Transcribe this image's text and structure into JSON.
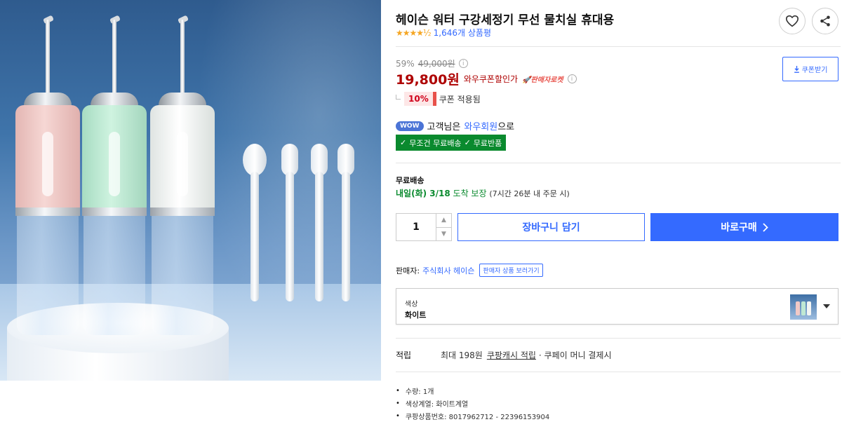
{
  "product": {
    "title": "헤이슨 워터 구강세정기 무선 물치실 휴대용",
    "rating_stars": "★★★★½",
    "review_count": "1,646개 상품평"
  },
  "price": {
    "discount_rate": "59%",
    "original_price": "49,000원",
    "sale_price": "19,800원",
    "sale_label": "와우쿠폰할인가",
    "seller_badge": "판매자로켓",
    "coupon_button": "쿠폰받기"
  },
  "coupon": {
    "percent": "10%",
    "applied_text": "쿠폰 적용됨"
  },
  "wow": {
    "badge": "WOW",
    "prefix": "고객님은",
    "member": "와우회원",
    "suffix": "으로",
    "benefit_1": "무조건 무료배송",
    "benefit_2": "무료반품"
  },
  "shipping": {
    "label": "무료배송",
    "date": "내일(화) 3/18",
    "guarantee": "도착 보장",
    "note": "(7시간 26분 내 주문 시)"
  },
  "purchase": {
    "quantity": "1",
    "cart_button": "장바구니 담기",
    "buy_button": "바로구매"
  },
  "seller": {
    "label": "판매자:",
    "name": "주식회사 헤이슨",
    "tag": "판매자 상품 보러가기"
  },
  "option": {
    "label": "색상",
    "value": "화이트"
  },
  "reward": {
    "label": "적립",
    "prefix": "최대 198원",
    "cash": "쿠팡캐시 적립",
    "suffix": "· 쿠페이 머니 결제시"
  },
  "specs": [
    "수량: 1개",
    "색상계열: 화이트계열",
    "쿠팡상품번호: 8017962712 - 22396153904"
  ],
  "colors": {
    "accent": "#346aff",
    "sale": "#ae0000",
    "wow_green": "#0a8a2e",
    "device_pink": "#f1c9c6",
    "device_mint": "#bfe8d3",
    "device_white": "#f3f5f4"
  },
  "icons": {
    "favorite": "heart-icon",
    "share": "share-icon",
    "download": "download-icon",
    "check": "check-icon",
    "chevron": "chevron-right-icon",
    "caret": "caret-down-icon"
  }
}
